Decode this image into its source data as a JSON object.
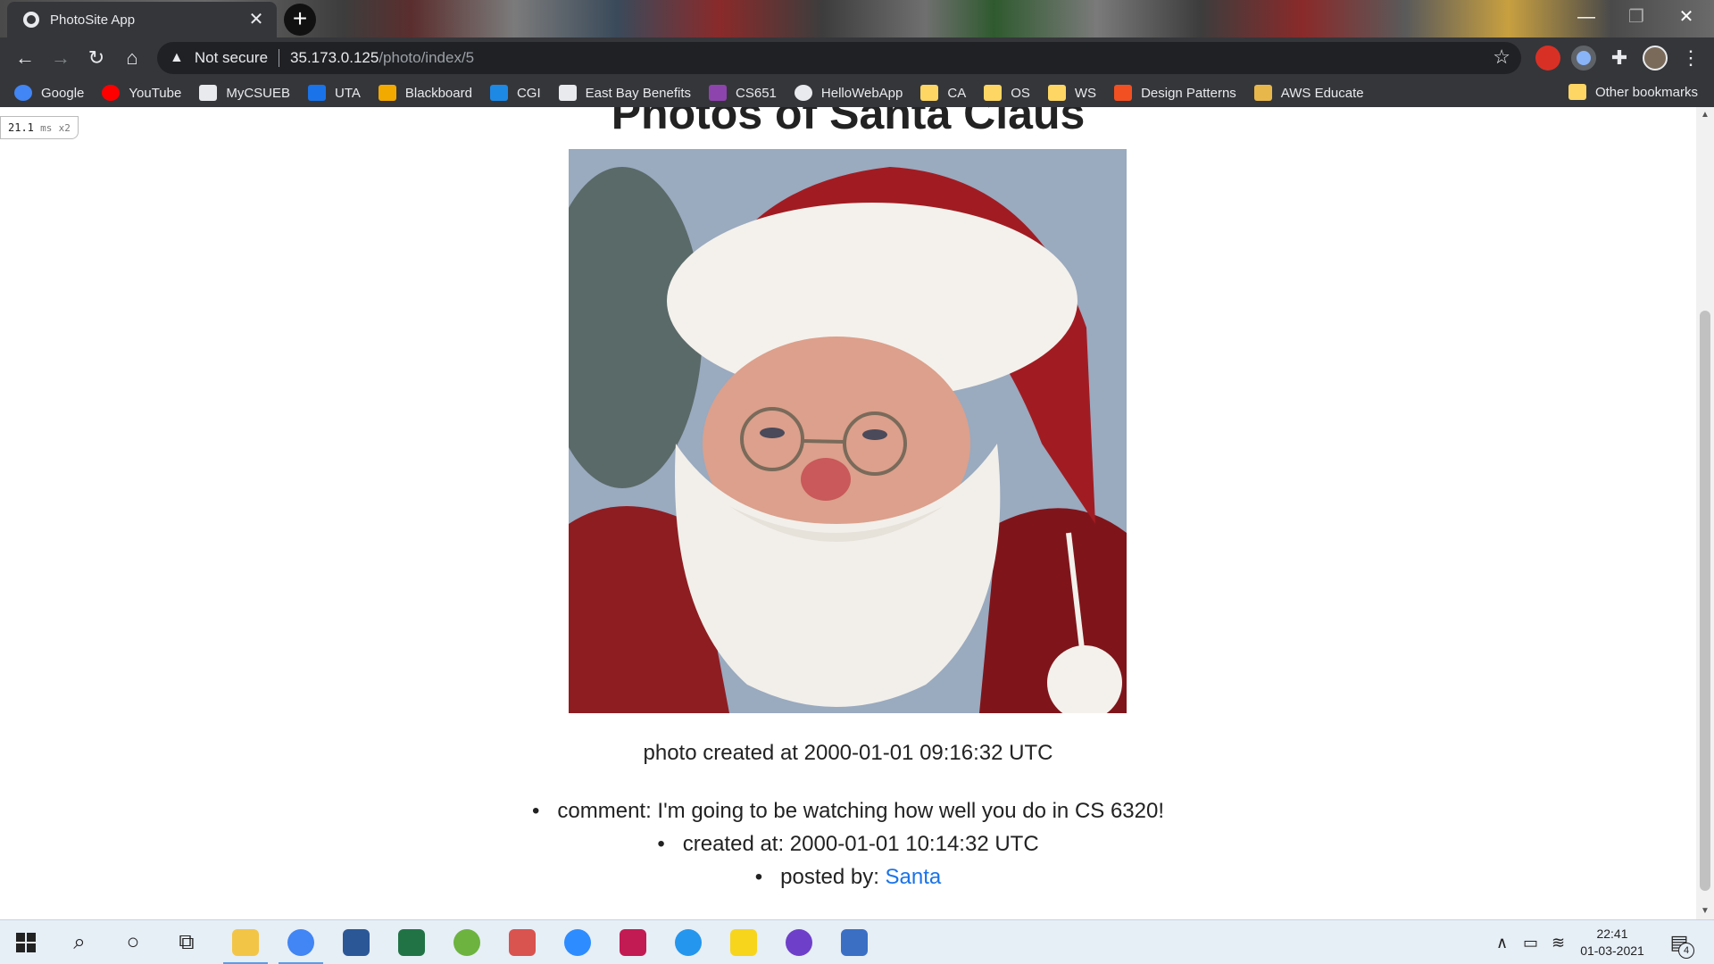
{
  "browser": {
    "tab_title": "PhotoSite App",
    "tab_close_glyph": "✕",
    "new_tab_glyph": "+",
    "window_controls": {
      "minimize": "—",
      "restore": "❐",
      "close": "✕"
    },
    "nav": {
      "back": "←",
      "forward": "→",
      "reload": "↻",
      "home": "⌂"
    },
    "security_label": "Not secure",
    "url_host": "35.173.0.125",
    "url_path": "/photo/index/5",
    "bookmarks": [
      {
        "label": "Google",
        "icon": "google-icon",
        "color": "#4285f4"
      },
      {
        "label": "YouTube",
        "icon": "youtube-icon",
        "color": "#ff0000"
      },
      {
        "label": "MyCSUEB",
        "icon": "eb-icon",
        "color": "#e8eaed"
      },
      {
        "label": "UTA",
        "icon": "uta-icon",
        "color": "#1a73e8"
      },
      {
        "label": "Blackboard",
        "icon": "blackboard-icon",
        "color": "#f2a900"
      },
      {
        "label": "CGI",
        "icon": "cgi-icon",
        "color": "#1e88e5"
      },
      {
        "label": "East Bay Benefits",
        "icon": "eb-icon",
        "color": "#e8eaed"
      },
      {
        "label": "CS651",
        "icon": "cs651-icon",
        "color": "#8e44ad"
      },
      {
        "label": "HelloWebApp",
        "icon": "globe-icon",
        "color": "#e8eaed"
      },
      {
        "label": "CA",
        "icon": "folder-icon",
        "color": "#fdd663"
      },
      {
        "label": "OS",
        "icon": "folder-icon",
        "color": "#fdd663"
      },
      {
        "label": "WS",
        "icon": "folder-icon",
        "color": "#fdd663"
      },
      {
        "label": "Design Patterns",
        "icon": "microsoft-icon",
        "color": "#f25022"
      },
      {
        "label": "AWS Educate",
        "icon": "aws-box-icon",
        "color": "#e7b74b"
      }
    ],
    "other_bookmarks": "Other bookmarks"
  },
  "timing": {
    "value": "21.1",
    "unit": "ms",
    "multiplier": "x2"
  },
  "page": {
    "title": "Photos of Santa Claus",
    "photo_alt": "Santa Claus portrait",
    "photo_created": "photo created at 2000-01-01 09:16:32 UTC",
    "comment": {
      "text": "comment: I'm going to be watching how well you do in CS 6320!",
      "created": "created at: 2000-01-01 10:14:32 UTC",
      "posted_by_label": "posted by: ",
      "posted_by_user": "Santa"
    }
  },
  "taskbar": {
    "apps": [
      {
        "name": "file-explorer",
        "color": "#f3c547"
      },
      {
        "name": "chrome",
        "color": "#4285f4"
      },
      {
        "name": "word",
        "color": "#2b5797"
      },
      {
        "name": "excel",
        "color": "#217346"
      },
      {
        "name": "spring-tool",
        "color": "#6db33f"
      },
      {
        "name": "snipping-tool",
        "color": "#d9534f"
      },
      {
        "name": "zoom",
        "color": "#2d8cff"
      },
      {
        "name": "rubymine",
        "color": "#c21a52"
      },
      {
        "name": "docker",
        "color": "#2496ed"
      },
      {
        "name": "sticky-notes",
        "color": "#f7d51d"
      },
      {
        "name": "github-desktop",
        "color": "#6e40c9"
      },
      {
        "name": "network-app",
        "color": "#3a6fc4"
      }
    ],
    "time": "22:41",
    "date": "01-03-2021",
    "notification_count": "4"
  },
  "colors": {
    "accent_link": "#1a73e8",
    "chrome_dark": "#35363a",
    "taskbar": "#e6eef6"
  }
}
